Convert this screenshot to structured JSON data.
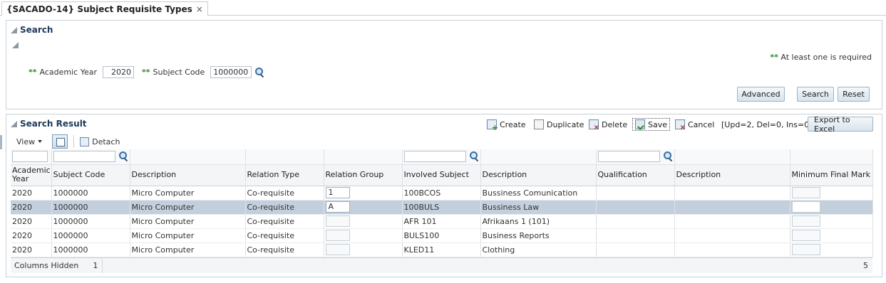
{
  "tab": {
    "title": "{SACADO-14} Subject Requisite Types",
    "close": "×"
  },
  "search_panel": {
    "title": "Search",
    "required_marker": "**",
    "required_note": "At least one is required",
    "fields": {
      "academic_year": {
        "label": "Academic Year",
        "value": "2020"
      },
      "subject_code": {
        "label": "Subject Code",
        "value": "1000000"
      }
    },
    "buttons": {
      "advanced": "Advanced",
      "search": "Search",
      "reset": "Reset"
    }
  },
  "result_panel": {
    "title": "Search Result",
    "toolbar": {
      "create": "Create",
      "duplicate": "Duplicate",
      "delete": "Delete",
      "save": "Save",
      "cancel": "Cancel",
      "status": "[Upd=2, Del=0, Ins=0]",
      "export": "Export to Excel"
    },
    "view_label": "View",
    "detach_label": "Detach",
    "columns": [
      "Academic Year",
      "Subject Code",
      "Description",
      "Relation Type",
      "Relation Group",
      "Involved Subject",
      "Description",
      "Qualification",
      "Description",
      "Minimum Final Mark"
    ],
    "rows": [
      {
        "year": "2020",
        "code": "1000000",
        "desc": "Micro Computer",
        "relation": "Co-requisite",
        "group": "1",
        "involved": "100BCOS",
        "involved_desc": "Bussiness Comunication",
        "qual": "",
        "qual_desc": "",
        "min_mark": ""
      },
      {
        "year": "2020",
        "code": "1000000",
        "desc": "Micro Computer",
        "relation": "Co-requisite",
        "group": "A",
        "involved": "100BULS",
        "involved_desc": "Bussiness Law",
        "qual": "",
        "qual_desc": "",
        "min_mark": ""
      },
      {
        "year": "2020",
        "code": "1000000",
        "desc": "Micro Computer",
        "relation": "Co-requisite",
        "group": "",
        "involved": "AFR 101",
        "involved_desc": "Afrikaans 1 (101)",
        "qual": "",
        "qual_desc": "",
        "min_mark": ""
      },
      {
        "year": "2020",
        "code": "1000000",
        "desc": "Micro Computer",
        "relation": "Co-requisite",
        "group": "",
        "involved": "BULS100",
        "involved_desc": "Business Reports",
        "qual": "",
        "qual_desc": "",
        "min_mark": ""
      },
      {
        "year": "2020",
        "code": "1000000",
        "desc": "Micro Computer",
        "relation": "Co-requisite",
        "group": "",
        "involved": "KLED11",
        "involved_desc": "Clothing",
        "qual": "",
        "qual_desc": "",
        "min_mark": ""
      }
    ],
    "footer": {
      "columns_hidden_label": "Columns Hidden",
      "columns_hidden_count": "1",
      "row_count": "5"
    }
  }
}
